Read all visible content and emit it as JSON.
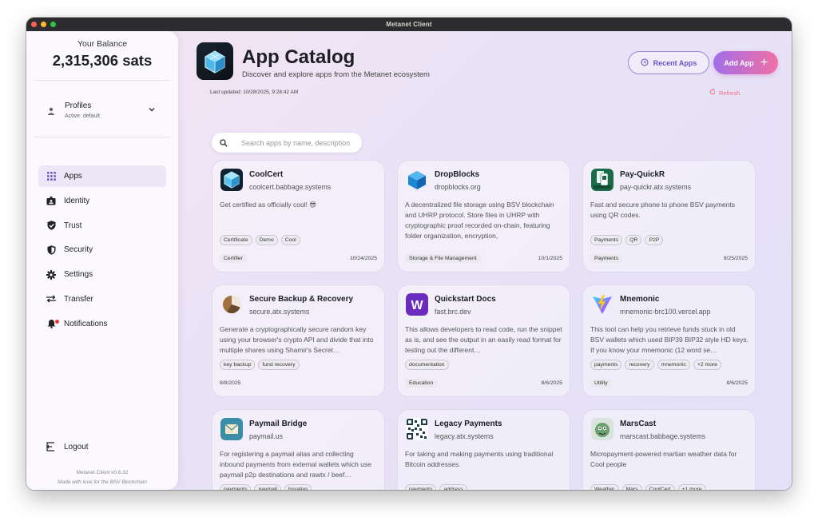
{
  "window": {
    "title": "Metanet Client"
  },
  "sidebar": {
    "balance_label": "Your Balance",
    "balance_value": "2,315,306 sats",
    "profiles_title": "Profiles",
    "profiles_active": "Active: default",
    "items": [
      {
        "label": "Apps",
        "icon": "grid-icon",
        "active": true
      },
      {
        "label": "Identity",
        "icon": "id-badge-icon"
      },
      {
        "label": "Trust",
        "icon": "shield-check-icon"
      },
      {
        "label": "Security",
        "icon": "shield-half-icon"
      },
      {
        "label": "Settings",
        "icon": "gear-icon"
      },
      {
        "label": "Transfer",
        "icon": "swap-arrows-icon"
      },
      {
        "label": "Notifications",
        "icon": "bell-icon"
      }
    ],
    "logout_label": "Logout",
    "version": "Metanet Client v0.6.32",
    "tagline": "Made with love for the BSV Blockchain"
  },
  "header": {
    "title": "App Catalog",
    "subtitle": "Discover and explore apps from the Metanet ecosystem",
    "recent_label": "Recent Apps",
    "add_label": "Add App",
    "last_updated": "Last updated: 10/28/2025, 9:28:42 AM",
    "refresh_label": "Refresh"
  },
  "search": {
    "placeholder": "Search apps by name, description",
    "value": ""
  },
  "colors": {
    "accent": "#8b6fdc",
    "add_gradient_start": "#a26de8",
    "add_gradient_end": "#f070a5",
    "refresh": "#ef6e86"
  },
  "cards": [
    {
      "name": "CoolCert",
      "domain": "coolcert.babbage.systems",
      "description": "Get certified as officially cool! 😎",
      "tags": [
        "Certificate",
        "Demo",
        "Cool"
      ],
      "category": "Certifier",
      "date": "10/24/2025",
      "icon": "coolcert-icon"
    },
    {
      "name": "DropBlocks",
      "domain": "dropblocks.org",
      "description": "A decentralized file storage using BSV blockchain and UHRP protocol. Store files in UHRP with cryptographic proof recorded on-chain, featuring folder organization, encryption,",
      "tags": [],
      "category": "Storage & File Management",
      "date": "10/1/2025",
      "icon": "blue-cube-icon"
    },
    {
      "name": "Pay-QuickR",
      "domain": "pay-quickr.atx.systems",
      "description": "Fast and secure phone to phone BSV payments using QR codes.",
      "tags": [
        "Payments",
        "QR",
        "P2P"
      ],
      "category": "Payments",
      "date": "9/25/2025",
      "icon": "pay-quickr-icon"
    },
    {
      "name": "Secure Backup & Recovery",
      "domain": "secure.atx.systems",
      "description": "Generate a cryptographically secure random key using your browser's crypto API and divide that into multiple shares using Shamir's Secret…",
      "tags": [
        "key backup",
        "fund recovery"
      ],
      "category": "",
      "date": "8/8/2025",
      "icon": "pie-chart-icon"
    },
    {
      "name": "Quickstart Docs",
      "domain": "fast.brc.dev",
      "description": "This allows developers to read code, run the snippet as is, and see the output in an easily read format for testing out the different…",
      "tags": [
        "documentation"
      ],
      "category": "Education",
      "date": "8/6/2025",
      "icon": "w-letter-icon"
    },
    {
      "name": "Mnemonic",
      "domain": "mnemonic-brc100.vercel.app",
      "description": "This tool can help you retrieve funds stuck in old BSV wallets which used BIP39 BIP32 style HD keys. If you know your mnemonic (12 word se…",
      "tags": [
        "payments",
        "recovery",
        "mnemonic",
        "+2 more"
      ],
      "category": "Utility",
      "date": "8/6/2025",
      "icon": "vite-logo-icon"
    },
    {
      "name": "Paymail Bridge",
      "domain": "paymail.us",
      "description": "For registering a paymail alias and collecting inbound payments from external wallets which use paymail p2p destinations and rawtx / beef…",
      "tags": [
        "payments",
        "paymail",
        "bsvalias"
      ],
      "category": "",
      "date": "",
      "icon": "envelope-icon"
    },
    {
      "name": "Legacy Payments",
      "domain": "legacy.atx.systems",
      "description": "For taking and making payments using traditional Bitcoin addresses.",
      "tags": [
        "payments",
        "address"
      ],
      "category": "",
      "date": "",
      "icon": "qr-code-icon"
    },
    {
      "name": "MarsCast",
      "domain": "marscast.babbage.systems",
      "description": "Micropayment-powered martian weather data for Cool people",
      "tags": [
        "Weather",
        "Mars",
        "CoolCert",
        "+1 more"
      ],
      "category": "",
      "date": "",
      "icon": "mars-icon"
    }
  ]
}
